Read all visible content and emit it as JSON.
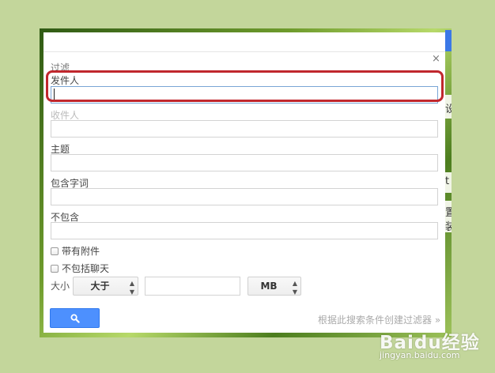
{
  "dialog": {
    "title": "过滤",
    "close_glyph": "×",
    "fields": [
      {
        "label": "发件人",
        "value": ""
      },
      {
        "label": "收件人",
        "value": ""
      },
      {
        "label": "主题",
        "value": ""
      },
      {
        "label": "包含字词",
        "value": ""
      },
      {
        "label": "不包含",
        "value": ""
      }
    ],
    "checkboxes": [
      {
        "label": "带有附件",
        "checked": false
      },
      {
        "label": "不包括聊天",
        "checked": false
      }
    ],
    "size": {
      "label": "大小",
      "comparator": "大于",
      "value": "",
      "unit": "MB"
    },
    "search_icon": "magnifier-icon",
    "create_filter_link": "根据此搜索条件创建过滤器 »"
  },
  "background_fragments": [
    "设",
    "t",
    "置",
    "装"
  ],
  "watermark": {
    "logo": "Baidu经验",
    "url": "jingyan.baidu.com"
  },
  "colors": {
    "accent": "#4d90fe",
    "highlight": "#c0272d",
    "page_bg": "#c3d69b"
  }
}
